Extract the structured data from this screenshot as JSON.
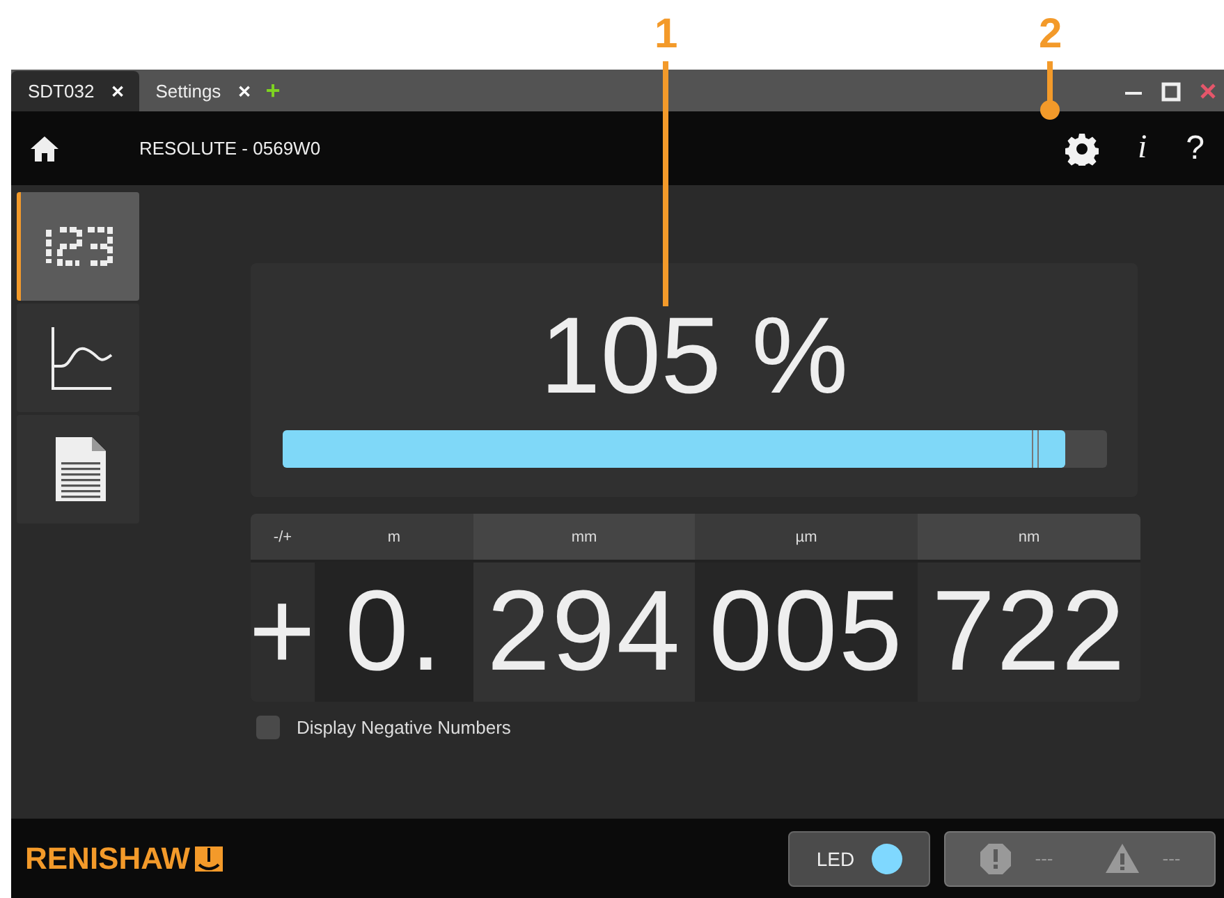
{
  "callouts": [
    {
      "label": "1"
    },
    {
      "label": "2"
    }
  ],
  "tabs": [
    {
      "label": "SDT032",
      "selected": true,
      "close": "✕"
    },
    {
      "label": "Settings",
      "selected": false,
      "close": "✕"
    }
  ],
  "add_tab": "+",
  "header": {
    "title": "RESOLUTE - 0569W0",
    "info": "i",
    "help": "?"
  },
  "sidebar": {
    "items": [
      {
        "kind": "digits",
        "selected": true
      },
      {
        "kind": "graph",
        "selected": false
      },
      {
        "kind": "report",
        "selected": false
      }
    ]
  },
  "signal": {
    "reading": "105 %",
    "level": 0.95
  },
  "readout": {
    "columns": [
      {
        "unit": "-/+",
        "value": "+"
      },
      {
        "unit": "m",
        "value": "0."
      },
      {
        "unit": "mm",
        "value": "294"
      },
      {
        "unit": "µm",
        "value": "005"
      },
      {
        "unit": "nm",
        "value": "722"
      }
    ]
  },
  "negative_numbers": {
    "label": "Display Negative Numbers",
    "checked": false
  },
  "footer": {
    "logo": "RENISHAW",
    "led": {
      "label": "LED",
      "color": "#7fd8ff"
    },
    "error": "---",
    "warning": "---"
  }
}
